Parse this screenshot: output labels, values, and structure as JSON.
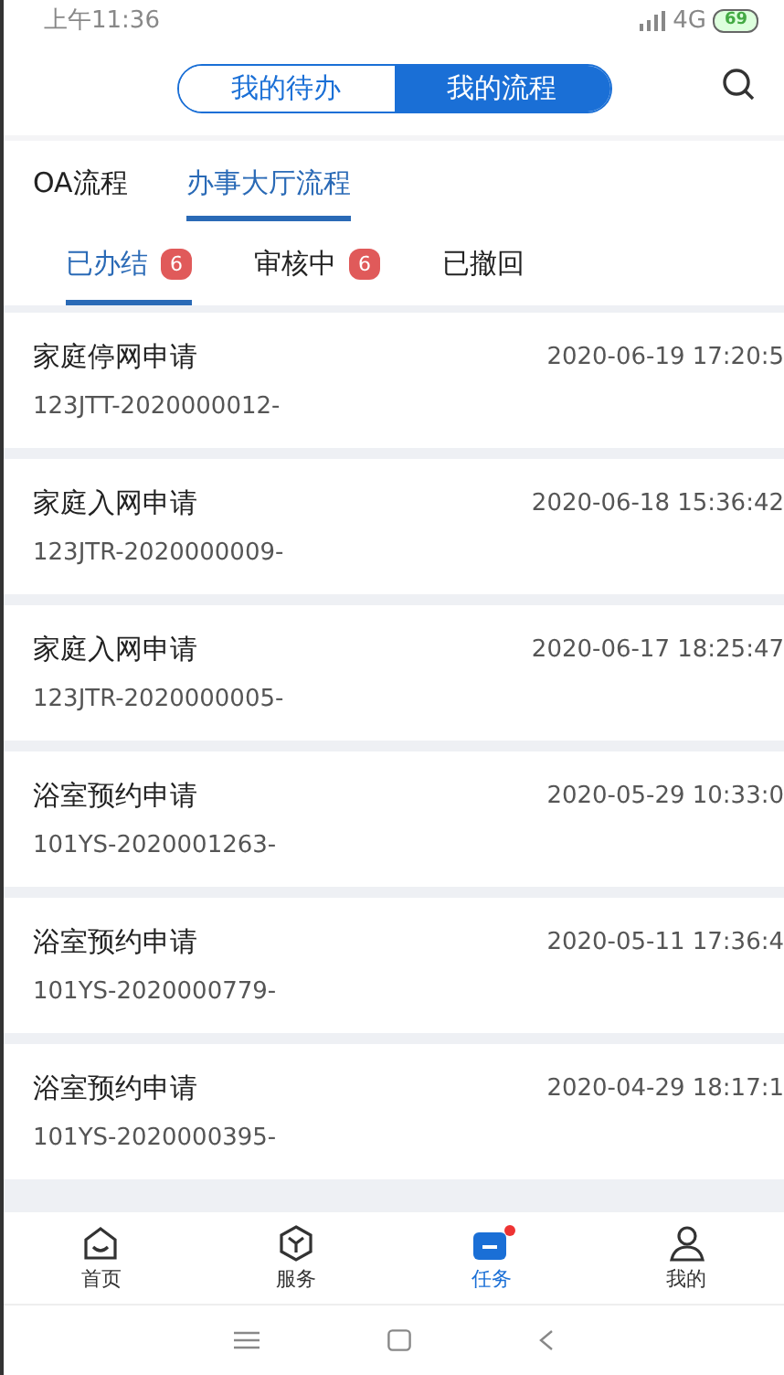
{
  "status_bar": {
    "time": "上午11:36",
    "network": "4G",
    "battery": "69"
  },
  "header": {
    "segments": [
      {
        "label": "我的待办",
        "selected": false
      },
      {
        "label": "我的流程",
        "selected": true
      }
    ]
  },
  "tabs": [
    {
      "label": "OA流程",
      "selected": false
    },
    {
      "label": "办事大厅流程",
      "selected": true
    }
  ],
  "sub_tabs": [
    {
      "label": "已办结",
      "badge": "6",
      "selected": true
    },
    {
      "label": "审核中",
      "badge": "6",
      "selected": false
    },
    {
      "label": "已撤回",
      "selected": false
    }
  ],
  "items": [
    {
      "title": "家庭停网申请",
      "time": "2020-06-19 17:20:5",
      "code": "123JTT-2020000012-"
    },
    {
      "title": "家庭入网申请",
      "time": "2020-06-18 15:36:42",
      "code": "123JTR-2020000009-"
    },
    {
      "title": "家庭入网申请",
      "time": "2020-06-17 18:25:47",
      "code": "123JTR-2020000005-"
    },
    {
      "title": "浴室预约申请",
      "time": "2020-05-29 10:33:0",
      "code": "101YS-2020001263-"
    },
    {
      "title": "浴室预约申请",
      "time": "2020-05-11 17:36:4",
      "code": "101YS-2020000779-"
    },
    {
      "title": "浴室预约申请",
      "time": "2020-04-29 18:17:1",
      "code": "101YS-2020000395-"
    }
  ],
  "bottom_nav": [
    {
      "label": "首页",
      "kind": "home",
      "selected": false,
      "dot": false
    },
    {
      "label": "服务",
      "kind": "service",
      "selected": false,
      "dot": false
    },
    {
      "label": "任务",
      "kind": "task",
      "selected": true,
      "dot": true
    },
    {
      "label": "我的",
      "kind": "user",
      "selected": false,
      "dot": false
    }
  ]
}
